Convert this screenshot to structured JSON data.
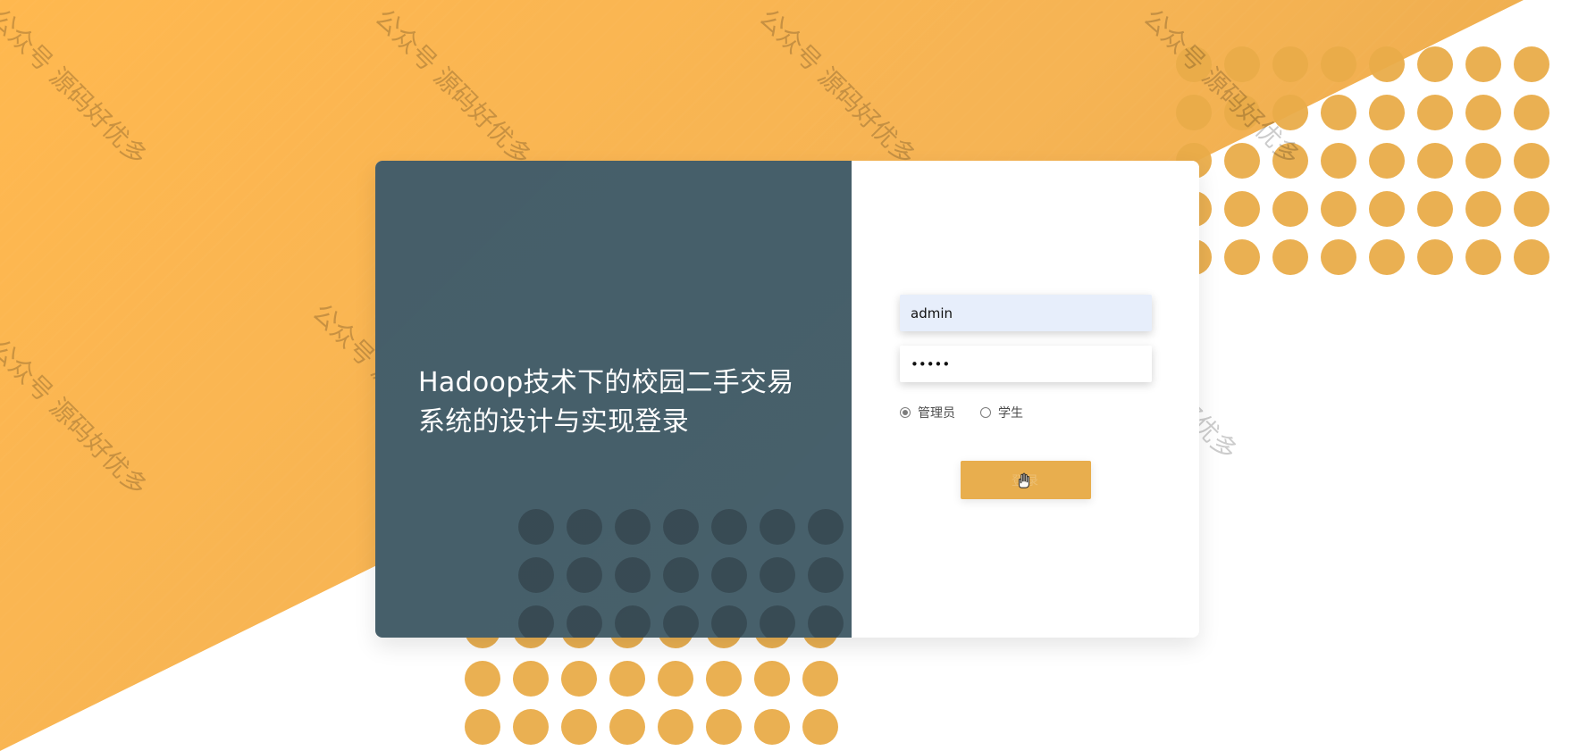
{
  "watermark": {
    "text_lines": [
      "公众号 源码好优多",
      "公众号 源码好优多",
      "公众号 源码好优多",
      "公众号 源码好优多",
      "公众号 源码好优多",
      "公众号 源码好优多",
      "公众号 源码好优多",
      "公众号 源码好优多"
    ]
  },
  "login": {
    "title": "Hadoop技术下的校园二手交易系统的设计与实现登录",
    "username_value": "admin",
    "password_value": "•••••",
    "roles": [
      {
        "label": "管理员",
        "selected": true
      },
      {
        "label": "学生",
        "selected": false
      }
    ],
    "submit_label": "登录"
  },
  "colors": {
    "orange_bg": "#F6B454",
    "orange_dots": "#E9AC49",
    "left_panel": "#47606B",
    "button": "#E8AE4E",
    "username_field_bg": "#E7EEFB"
  },
  "icons": {
    "cursor": "hand-cursor-icon"
  }
}
